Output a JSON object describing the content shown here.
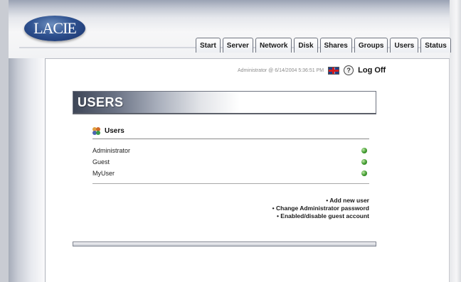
{
  "header": {
    "logo_text": "LACIE",
    "tabs": [
      "Start",
      "Server",
      "Network",
      "Disk",
      "Shares",
      "Groups",
      "Users",
      "Status"
    ]
  },
  "info": {
    "admin_line": "Administrator @ 6/14/2004 5:36:51 PM",
    "help_glyph": "?",
    "logoff_label": "Log Off"
  },
  "page": {
    "title": "USERS"
  },
  "users_panel": {
    "heading": "Users",
    "users": [
      "Administrator",
      "Guest",
      "MyUser"
    ]
  },
  "actions": [
    "• Add new user",
    "• Change Administrator password",
    "• Enabled/disable guest account"
  ],
  "colors": {
    "status_ok": "#3f9b2e",
    "logo_blue": "#2f5290"
  }
}
